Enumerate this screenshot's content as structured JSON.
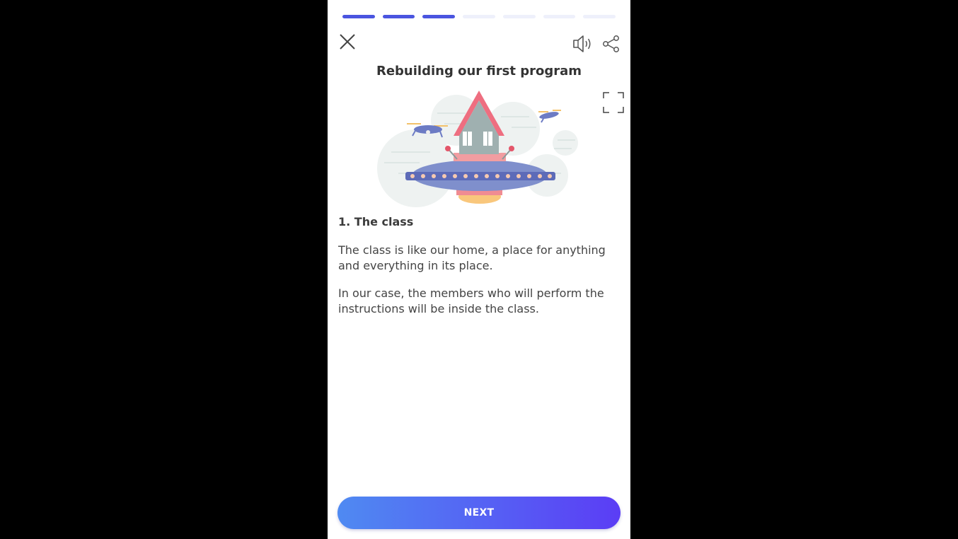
{
  "lesson": {
    "progress": {
      "total_steps": 7,
      "completed_steps": 3
    },
    "title": "Rebuilding our first program",
    "section_heading": "1. The class",
    "paragraphs": [
      "The class is like our home, a place for anything and everything in its place.",
      "In our case, the members who will perform the instructions will be inside the class."
    ],
    "next_label": "NEXT"
  },
  "icons": {
    "close": "close-icon",
    "audio": "speaker-icon",
    "share": "share-icon",
    "expand": "fullscreen-icon"
  },
  "colors": {
    "progress_done": "#4a55e0",
    "progress_pending": "#eef0fb",
    "button_gradient_start": "#4f8af2",
    "button_gradient_end": "#5b3df5",
    "background": "#000000"
  }
}
